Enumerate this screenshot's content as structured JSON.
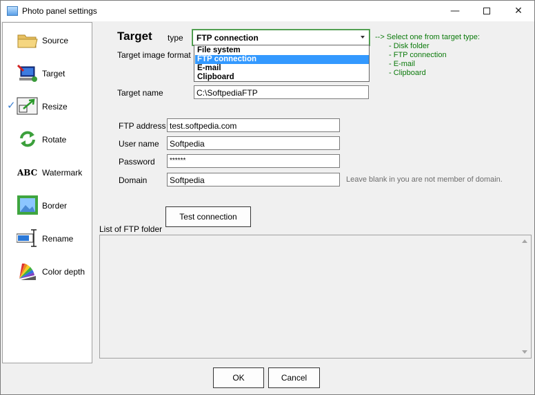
{
  "window": {
    "title": "Photo panel settings",
    "minimize": "—",
    "close": "✕"
  },
  "sidebar": {
    "items": [
      {
        "label": "Source",
        "icon": "folder-icon"
      },
      {
        "label": "Target",
        "icon": "target-computer-icon"
      },
      {
        "label": "Resize",
        "icon": "resize-icon",
        "checked": true
      },
      {
        "label": "Rotate",
        "icon": "rotate-icon"
      },
      {
        "label": "Watermark",
        "icon": "watermark-icon",
        "icon_text": "ABC"
      },
      {
        "label": "Border",
        "icon": "border-icon"
      },
      {
        "label": "Rename",
        "icon": "rename-icon"
      },
      {
        "label": "Color depth",
        "icon": "color-depth-icon"
      }
    ],
    "check_glyph": "✓"
  },
  "main": {
    "heading": "Target",
    "type_label": "type",
    "type_selected": "FTP connection",
    "type_options": [
      "File system",
      "FTP connection",
      "E-mail",
      "Clipboard"
    ],
    "type_selected_index": 1,
    "image_format_label": "Target image format",
    "hints": {
      "intro": "-->  Select one from target type:",
      "lines": [
        "- Disk folder",
        "- FTP connection",
        "- E-mail",
        "- Clipboard"
      ]
    },
    "target_name_label": "Target name",
    "target_name_value": "C:\\SoftpediaFTP",
    "ftp_address_label": "FTP address",
    "ftp_address_value": "test.softpedia.com",
    "user_name_label": "User name",
    "user_name_value": "Softpedia",
    "password_label": "Password",
    "password_value": "******",
    "domain_label": "Domain",
    "domain_value": "Softpedia",
    "domain_hint": "Leave blank in you are not member of domain.",
    "test_connection_label": "Test connection",
    "ftp_folder_list_label": "List of FTP folder"
  },
  "footer": {
    "ok_label": "OK",
    "cancel_label": "Cancel"
  },
  "colors": {
    "hint_green": "#0b7a0b",
    "selection_blue": "#3399ff",
    "combo_border": "#3c8c3c"
  }
}
